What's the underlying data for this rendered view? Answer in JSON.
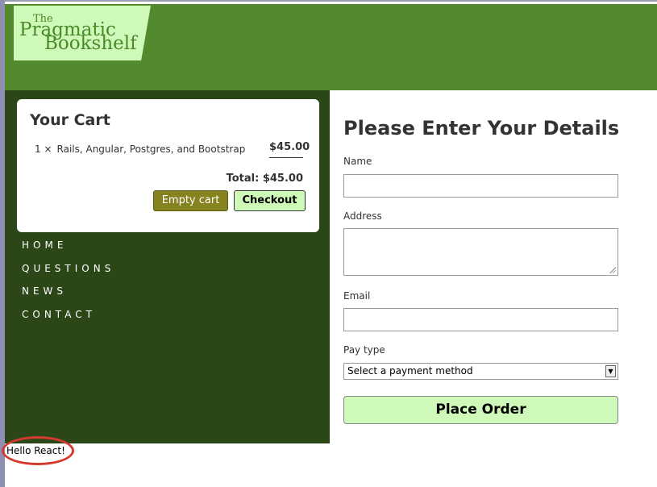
{
  "logo": {
    "line1": "The",
    "line2": "Pragmatic",
    "line3": "Bookshelf"
  },
  "cart": {
    "title": "Your Cart",
    "items": [
      {
        "qty": "1 ×",
        "title": "Rails, Angular, Postgres, and Bootstrap",
        "price": "$45.00"
      }
    ],
    "total_label": "Total: $45.00",
    "empty_label": "Empty cart",
    "checkout_label": "Checkout"
  },
  "nav": {
    "items": [
      "HOME",
      "QUESTIONS",
      "NEWS",
      "CONTACT"
    ]
  },
  "form": {
    "title": "Please Enter Your Details",
    "name_label": "Name",
    "name_value": "",
    "address_label": "Address",
    "email_label": "Email",
    "email_value": "",
    "pay_type_label": "Pay type",
    "pay_type_selected": "Select a payment method",
    "submit_label": "Place Order"
  },
  "react_text": "Hello React!",
  "colors": {
    "banner": "#548a2e",
    "sidebar": "#2b4718",
    "logo_bg": "#cff9b8",
    "empty_btn": "#858220",
    "annotation": "#d63a2e"
  }
}
